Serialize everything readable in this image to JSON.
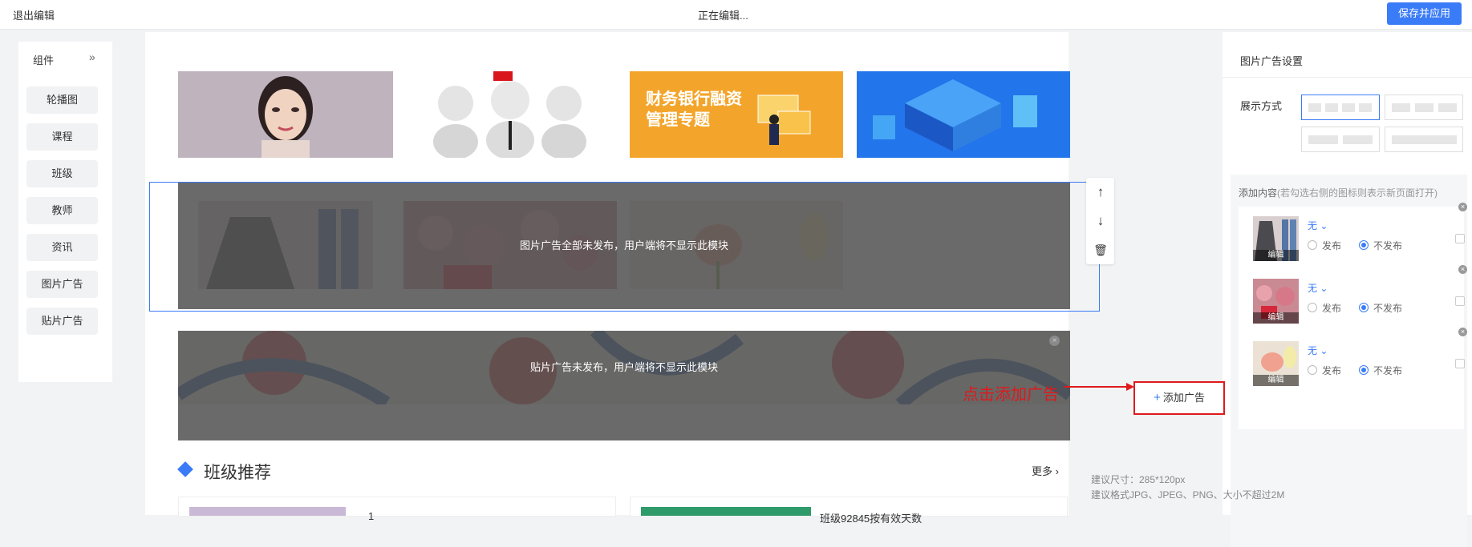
{
  "topbar": {
    "exit_label": "退出编辑",
    "status": "正在编辑...",
    "save_label": "保存并应用"
  },
  "components": {
    "title": "组件",
    "collapse_icon": "»",
    "items": [
      {
        "label": "轮播图"
      },
      {
        "label": "课程"
      },
      {
        "label": "班级"
      },
      {
        "label": "教师"
      },
      {
        "label": "资讯"
      },
      {
        "label": "图片广告"
      },
      {
        "label": "贴片广告"
      }
    ]
  },
  "canvas": {
    "banner_images": [
      {
        "kind": "portrait-photo"
      },
      {
        "kind": "3d-figures"
      },
      {
        "kind": "finance-banner",
        "text_line1": "财务银行融资",
        "text_line2": "管理专题"
      },
      {
        "kind": "isometric-city"
      }
    ],
    "image_ad_overlay": "图片广告全部未发布，用户端将不显示此模块",
    "patch_ad_overlay": "贴片广告未发布，用户端将不显示此模块",
    "section_title": "班级推荐",
    "more_label": "更多",
    "class_items": [
      {
        "title": "1"
      },
      {
        "title": "班级92845按有效天数"
      }
    ],
    "tools": {
      "up": "↑",
      "down": "↓",
      "delete": "🗑"
    }
  },
  "right": {
    "title": "图片广告设置",
    "display_label": "展示方式",
    "add_label": "添加内容",
    "add_hint": "(若勾选右侧的图标则表示新页面打开)",
    "ads": [
      {
        "link": "无",
        "publish": "发布",
        "unpublish": "不发布",
        "edit": "编辑"
      },
      {
        "link": "无",
        "publish": "发布",
        "unpublish": "不发布",
        "edit": "编辑"
      },
      {
        "link": "无",
        "publish": "发布",
        "unpublish": "不发布",
        "edit": "编辑"
      }
    ],
    "add_button": "添加广告",
    "spec_size": "建议尺寸：285*120px",
    "spec_format": "建议格式JPG、JPEG、PNG、大小不超过2M"
  },
  "annotation": {
    "text": "点击添加广告",
    "color": "#e0191c"
  },
  "colors": {
    "accent": "#3a7bf7",
    "annotation": "#e0191c"
  }
}
